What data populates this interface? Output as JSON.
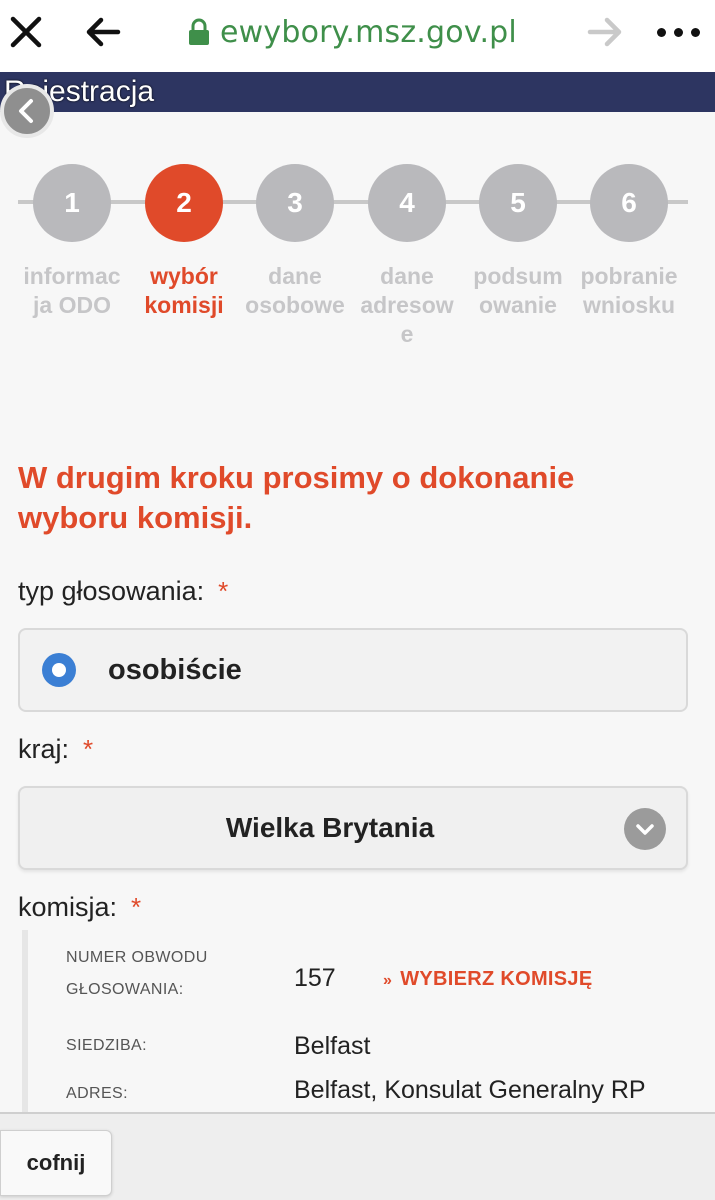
{
  "browser": {
    "url": "ewybory.msz.gov.pl"
  },
  "header": {
    "title": "Rejestracja"
  },
  "steps": [
    {
      "number": "1",
      "label_line1": "informac",
      "label_line2": "ja ODO",
      "label_line3": ""
    },
    {
      "number": "2",
      "label_line1": "wybór",
      "label_line2": "komisji",
      "label_line3": ""
    },
    {
      "number": "3",
      "label_line1": "dane",
      "label_line2": "osobowe",
      "label_line3": ""
    },
    {
      "number": "4",
      "label_line1": "dane",
      "label_line2": "adresow",
      "label_line3": "e"
    },
    {
      "number": "5",
      "label_line1": "podsum",
      "label_line2": "owanie",
      "label_line3": ""
    },
    {
      "number": "6",
      "label_line1": "pobranie",
      "label_line2": "wniosku",
      "label_line3": ""
    }
  ],
  "active_step": 2,
  "main": {
    "heading_line1": "W drugim kroku prosimy o dokonanie",
    "heading_line2": "wyboru komisji.",
    "required_mark": "*"
  },
  "voting_type": {
    "label": "typ głosowania:",
    "option": "osobiście"
  },
  "country": {
    "label": "kraj:",
    "value": "Wielka Brytania"
  },
  "commission": {
    "label": "komisja:",
    "number_key_line1": "NUMER OBWODU",
    "number_key_line2": "GŁOSOWANIA:",
    "number_value": "157",
    "choose_label": "WYBIERZ KOMISJĘ",
    "choose_chevron": "»",
    "seat_key": "SIEDZIBA:",
    "seat_value": "Belfast",
    "address_key": "ADRES:",
    "address_value": "Belfast, Konsulat Generalny RP"
  },
  "footer": {
    "back_label": "cofnij"
  },
  "colors": {
    "accent": "#e04a2a",
    "header": "#2d3561",
    "url": "#3f8f4a",
    "radio": "#3b7fd4"
  }
}
